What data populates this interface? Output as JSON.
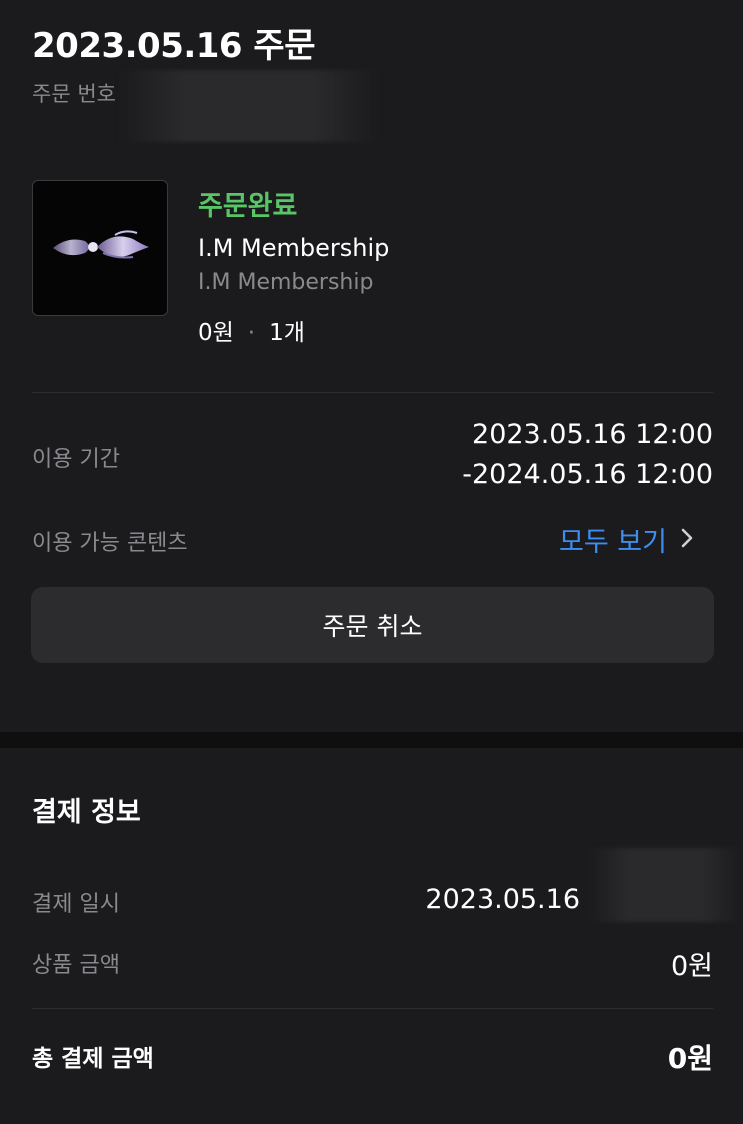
{
  "order": {
    "date_title": "2023.05.16 주문",
    "number_label": "주문 번호"
  },
  "product": {
    "status": "주문완료",
    "title": "I.M Membership",
    "subtitle": "I.M Membership",
    "price": "0원",
    "quantity": "1개"
  },
  "usage": {
    "period_label": "이용 기간",
    "period_start": "2023.05.16 12:00",
    "period_end": "-2024.05.16 12:00",
    "contents_label": "이용 가능 콘텐츠",
    "see_all_label": "모두 보기"
  },
  "cancel_button_label": "주문 취소",
  "payment": {
    "header": "결제 정보",
    "date_label": "결제 일시",
    "date_value": "2023.05.16",
    "amount_label": "상품 금액",
    "amount_value": "0원",
    "total_label": "총 결제 금액",
    "total_value": "0원"
  },
  "colors": {
    "status_green": "#58c566",
    "link_blue": "#3d8ef0",
    "background": "#1b1b1d",
    "button_bg": "#2c2c2e"
  }
}
